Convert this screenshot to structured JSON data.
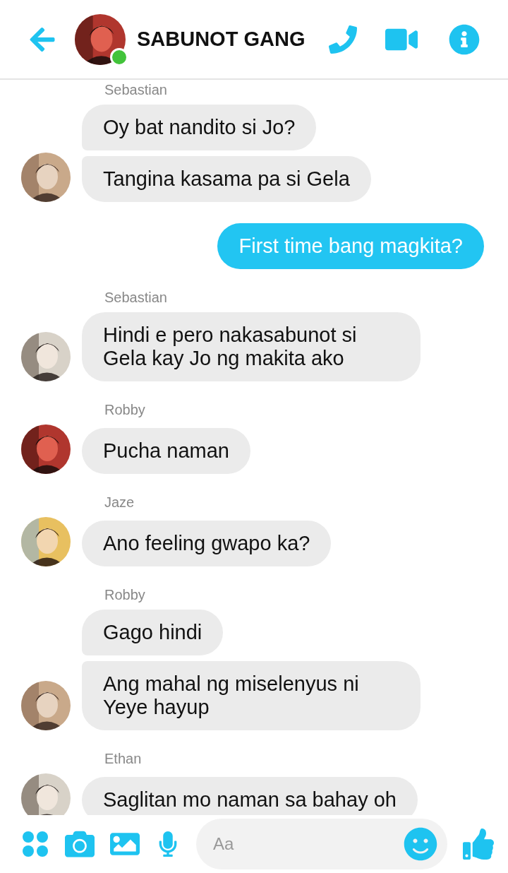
{
  "header": {
    "title": "SABUNOT GANG",
    "online": true
  },
  "messages": [
    {
      "kind": "incoming",
      "sender": "Sebastian",
      "bubbles": [
        "Oy bat nandito si Jo?",
        "Tangina kasama pa si Gela"
      ]
    },
    {
      "kind": "outgoing",
      "bubbles": [
        "First time bang magkita?"
      ]
    },
    {
      "kind": "incoming",
      "sender": "Sebastian",
      "bubbles": [
        "Hindi e pero nakasabunot si Gela kay Jo ng makita ako"
      ]
    },
    {
      "kind": "incoming",
      "sender": "Robby",
      "bubbles": [
        "Pucha naman"
      ]
    },
    {
      "kind": "incoming",
      "sender": "Jaze",
      "bubbles": [
        "Ano feeling gwapo ka?"
      ]
    },
    {
      "kind": "incoming",
      "sender": "Robby",
      "bubbles": [
        "Gago hindi",
        "Ang mahal ng miselenyus ni Yeye hayup"
      ]
    },
    {
      "kind": "incoming",
      "sender": "Ethan",
      "bubbles": [
        "Saglitan mo naman sa bahay oh"
      ]
    }
  ],
  "composer": {
    "placeholder": "Aa"
  }
}
